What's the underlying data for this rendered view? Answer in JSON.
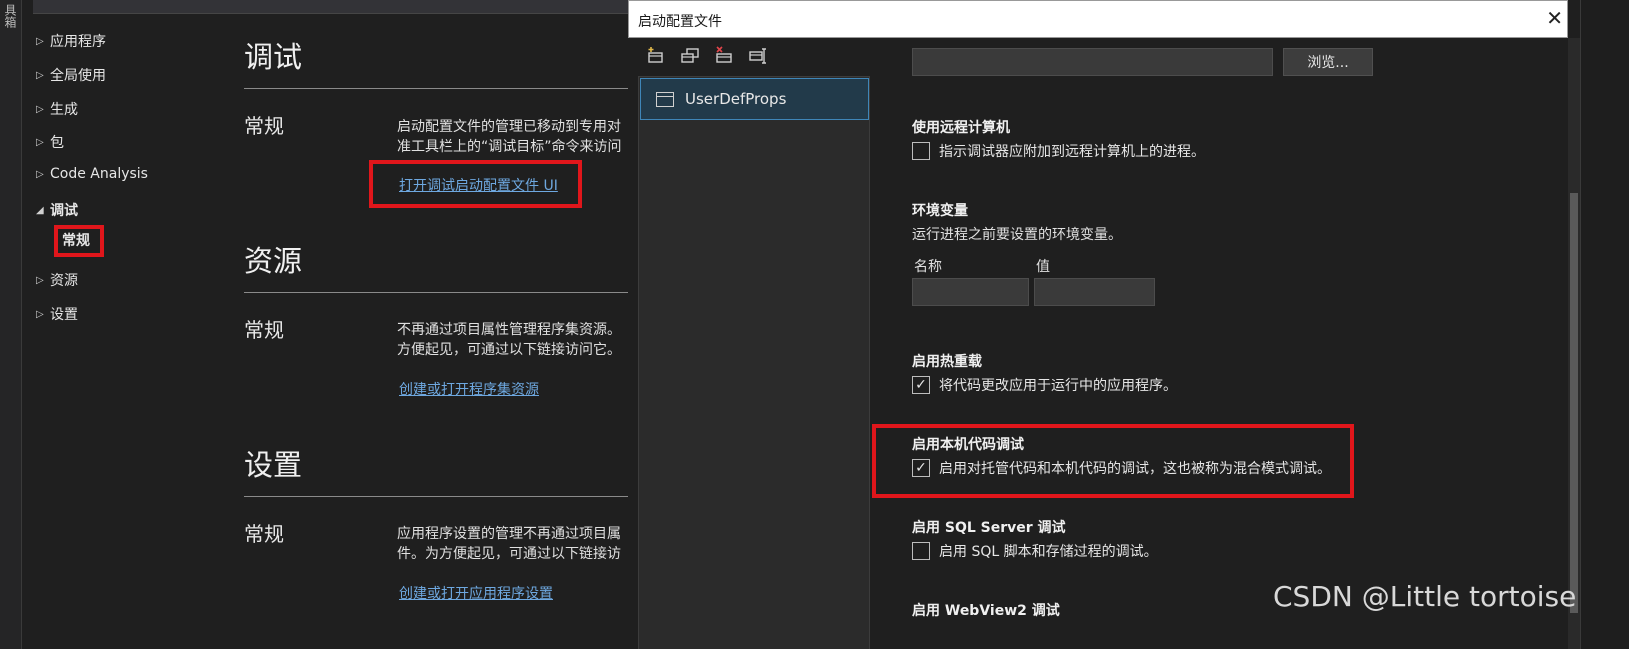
{
  "left_strip": {
    "vertical_text": "具箱"
  },
  "nav": {
    "items": [
      {
        "label": "应用程序",
        "expanded": false
      },
      {
        "label": "全局使用",
        "expanded": false
      },
      {
        "label": "生成",
        "expanded": false
      },
      {
        "label": "包",
        "expanded": false
      },
      {
        "label": "Code Analysis",
        "expanded": false
      },
      {
        "label": "调试",
        "expanded": true
      },
      {
        "label": "常规",
        "child": true
      },
      {
        "label": "资源",
        "expanded": false
      },
      {
        "label": "设置",
        "expanded": false
      }
    ]
  },
  "sections": [
    {
      "title": "调试",
      "sub": "常规",
      "desc_line1": "启动配置文件的管理已移动到专用对",
      "desc_line2": "准工具栏上的“调试目标”命令来访问",
      "link": "打开调试启动配置文件 UI"
    },
    {
      "title": "资源",
      "sub": "常规",
      "desc_line1": "不再通过项目属性管理程序集资源。",
      "desc_line2": "方便起见，可通过以下链接访问它。",
      "link": "创建或打开程序集资源"
    },
    {
      "title": "设置",
      "sub": "常规",
      "desc_line1": "应用程序设置的管理不再通过项目属",
      "desc_line2": "件。为方便起见，可通过以下链接访",
      "link": "创建或打开应用程序设置"
    }
  ],
  "dialog": {
    "title": "启动配置文件",
    "close_glyph": "✕",
    "toolbar": [
      "new-profile-icon",
      "copy-profile-icon",
      "delete-profile-icon",
      "rename-profile-icon"
    ],
    "profiles": [
      "UserDefProps"
    ],
    "browse_label": "浏览...",
    "remote": {
      "title": "使用远程计算机",
      "checkbox_label": "指示调试器应附加到远程计算机上的进程。",
      "checked": false
    },
    "env": {
      "title": "环境变量",
      "desc": "运行进程之前要设置的环境变量。",
      "col_name": "名称",
      "col_value": "值"
    },
    "hot_reload": {
      "title": "启用热重载",
      "checkbox_label": "将代码更改应用于运行中的应用程序。",
      "checked": true
    },
    "native": {
      "title": "启用本机代码调试",
      "checkbox_label": "启用对托管代码和本机代码的调试，这也被称为混合模式调试。",
      "checked": true
    },
    "sql": {
      "title": "启用 SQL Server 调试",
      "checkbox_label": "启用 SQL 脚本和存储过程的调试。",
      "checked": false
    },
    "webview": {
      "title": "启用 WebView2 调试"
    }
  },
  "watermark": "CSDN @Little tortoise",
  "colors": {
    "highlight_red": "#e0161b",
    "link_blue": "#6ea8e0",
    "selection_blue": "#3f86b8"
  }
}
